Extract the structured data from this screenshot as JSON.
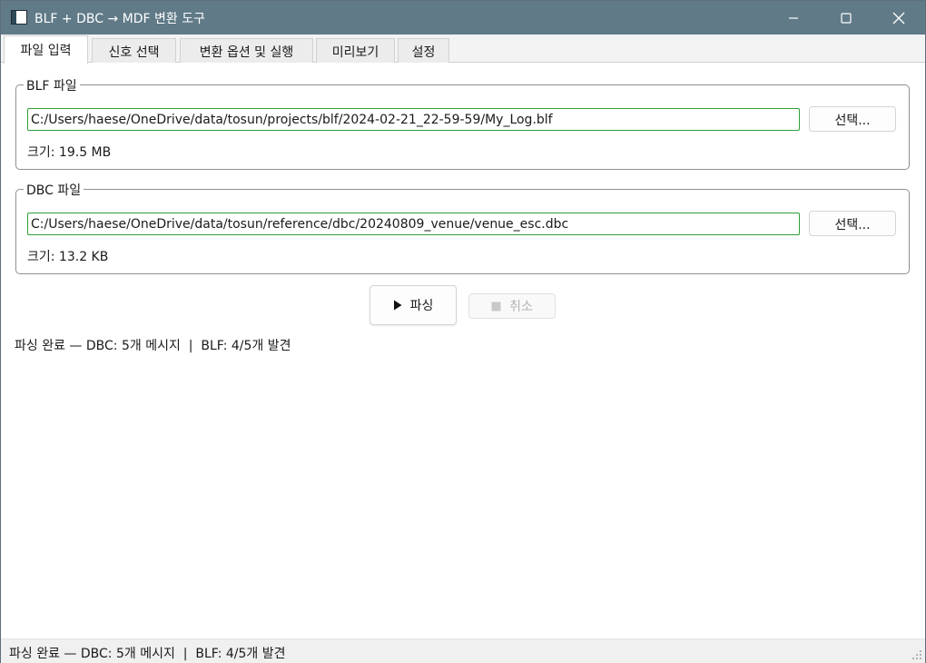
{
  "window": {
    "title": "BLF + DBC → MDF 변환 도구",
    "icons": {
      "app": "app-window-icon",
      "minimize": "minimize-icon",
      "maximize": "maximize-icon",
      "close": "close-icon"
    }
  },
  "tabs": [
    {
      "label": "파일 입력",
      "active": true
    },
    {
      "label": "신호 선택",
      "active": false
    },
    {
      "label": "변환 옵션 및 실행",
      "active": false
    },
    {
      "label": "미리보기",
      "active": false
    },
    {
      "label": "설정",
      "active": false
    }
  ],
  "blf": {
    "group_title": "BLF 파일",
    "path": "C:/Users/haese/OneDrive/data/tosun/projects/blf/2024-02-21_22-59-59/My_Log.blf",
    "select_label": "선택...",
    "size_text": "크기: 19.5 MB"
  },
  "dbc": {
    "group_title": "DBC 파일",
    "path": "C:/Users/haese/OneDrive/data/tosun/reference/dbc/20240809_venue/venue_esc.dbc",
    "select_label": "선택...",
    "size_text": "크기: 13.2 KB"
  },
  "actions": {
    "parse_label": "파싱",
    "parse_icon": "play-icon",
    "cancel_label": "취소",
    "cancel_icon": "stop-icon",
    "cancel_enabled": false
  },
  "status": {
    "message": "파싱 완료 — DBC: 5개 메시지  |  BLF: 4/5개 발견"
  },
  "statusbar": {
    "message": "파싱 완료 — DBC: 5개 메시지  |  BLF: 4/5개 발견"
  },
  "colors": {
    "titlebar": "#607a88",
    "input_border": "#2e9e3a"
  }
}
